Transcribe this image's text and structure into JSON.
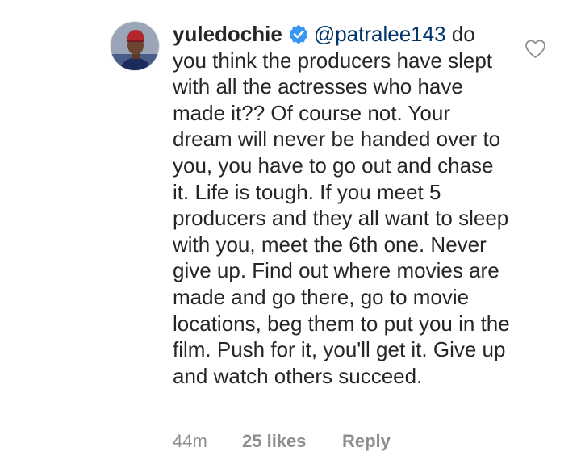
{
  "comment": {
    "username": "yuledochie",
    "mention": "@patralee143",
    "text": "do you think the producers have slept with all the actresses who have made it?? Of course not. Your dream will never be handed over to you, you have to go out and chase it. Life is tough. If you meet 5 producers and they all want to sleep with you, meet the 6th one. Never give up. Find out where movies are made and go there, go to movie locations, beg them to put you in the film. Push for it, you'll get it. Give up and watch others succeed."
  },
  "meta": {
    "time": "44m",
    "likes": "25 likes",
    "reply_label": "Reply"
  },
  "icons": {
    "verified": "verified-badge-icon",
    "like": "heart-outline-icon",
    "avatar": "profile-photo"
  },
  "colors": {
    "verified_badge": "#3897f0",
    "mention": "#003569",
    "meta_text": "#8e8e8e"
  }
}
